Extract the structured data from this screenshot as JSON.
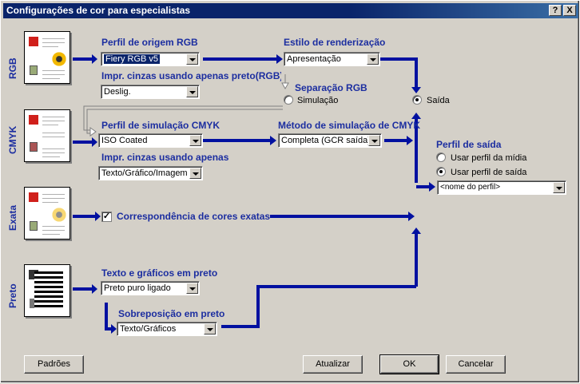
{
  "window": {
    "title": "Configurações de cor para especialistas",
    "help_label": "?",
    "close_label": "X"
  },
  "rows": {
    "rgb": "RGB",
    "cmyk": "CMYK",
    "exata": "Exata",
    "preto": "Preto"
  },
  "rgb": {
    "source_profile_label": "Perfil de origem RGB",
    "source_profile_value": "Fiery RGB v5",
    "gray_label": "Impr. cinzas usando apenas preto(RGB)",
    "gray_value": "Deslig.",
    "rendering_label": "Estilo de renderização",
    "rendering_value": "Apresentação",
    "separation_label": "Separação RGB",
    "separation_simulation": "Simulação",
    "separation_output": "Saída"
  },
  "cmyk": {
    "sim_profile_label": "Perfil de simulação CMYK",
    "sim_profile_value": "ISO Coated",
    "gray_label": "Impr. cinzas usando apenas",
    "gray_value": "Texto/Gráfico/Imagem",
    "method_label": "Método de simulação de CMYK",
    "method_value": "Completa (GCR saída)"
  },
  "output": {
    "label": "Perfil de saída",
    "use_media": "Usar perfil da mídia",
    "use_output": "Usar perfil de saída",
    "profile_value": "<nome do perfil>"
  },
  "exata": {
    "match_label": "Correspondência de cores exatas",
    "checked_mark": "✓"
  },
  "preto": {
    "text_label": "Texto e gráficos em preto",
    "text_value": "Preto puro ligado",
    "overprint_label": "Sobreposição em preto",
    "overprint_value": "Texto/Gráficos"
  },
  "buttons": {
    "defaults": "Padrões",
    "update": "Atualizar",
    "ok": "OK",
    "cancel": "Cancelar"
  },
  "colors": {
    "flow": "#0010a0",
    "label": "#1c2ea0",
    "title_bg": "#0a246a"
  }
}
